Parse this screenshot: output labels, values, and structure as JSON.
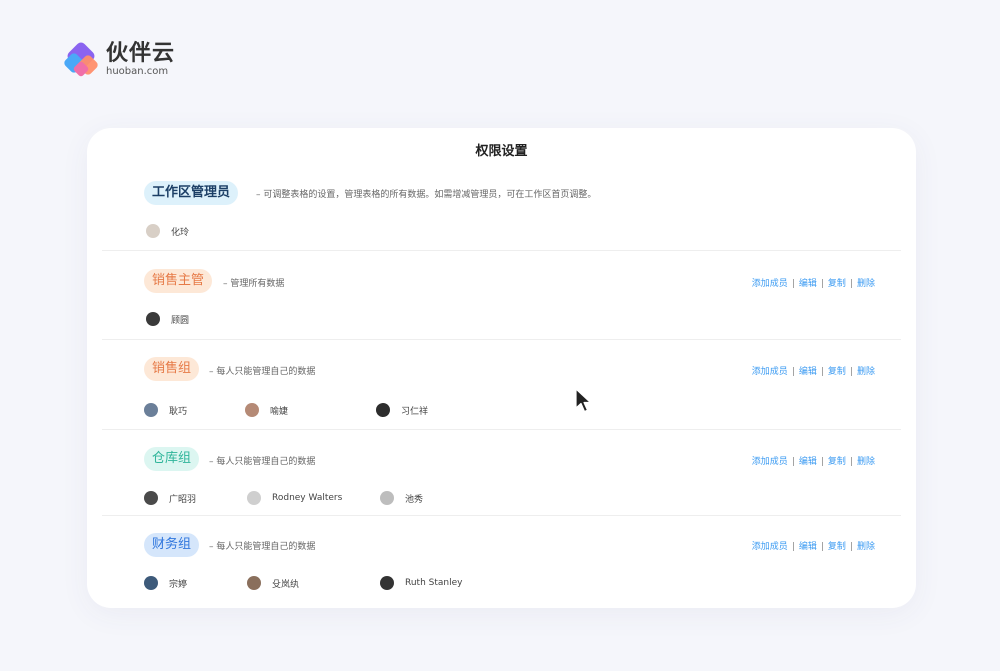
{
  "brand": {
    "name": "伙伴云",
    "domain": "huoban.com"
  },
  "panel": {
    "title": "权限设置"
  },
  "actions": {
    "add": "添加成员",
    "edit": "编辑",
    "copy": "复制",
    "delete": "删除",
    "separator": "|"
  },
  "groups": [
    {
      "name": "工作区管理员",
      "description": "– 可调整表格的设置，管理表格的所有数据。如需增减管理员，可在工作区首页调整。",
      "color": "#1c3f66",
      "members": [
        {
          "name": "化玲",
          "avatar_color": "#d8cfc6"
        }
      ]
    },
    {
      "name": "销售主管",
      "description": "– 管理所有数据",
      "color": "#e67a47",
      "members": [
        {
          "name": "顾圆",
          "avatar_color": "#3a3a3a"
        }
      ]
    },
    {
      "name": "销售组",
      "description": "– 每人只能管理自己的数据",
      "color": "#e67a47",
      "members": [
        {
          "name": "耿巧",
          "avatar_color": "#6b7f99"
        },
        {
          "name": "喻婕",
          "avatar_color": "#b58a76"
        },
        {
          "name": "习仁祥",
          "avatar_color": "#2d2d2d"
        }
      ]
    },
    {
      "name": "仓库组",
      "description": "– 每人只能管理自己的数据",
      "color": "#2fb59a",
      "members": [
        {
          "name": "广昭羽",
          "avatar_color": "#4a4a4a"
        },
        {
          "name": "Rodney Walters",
          "avatar_color": "#cfcfcf"
        },
        {
          "name": "池秀",
          "avatar_color": "#bdbdbd"
        }
      ]
    },
    {
      "name": "财务组",
      "description": "– 每人只能管理自己的数据",
      "color": "#2f76dd",
      "members": [
        {
          "name": "宗婷",
          "avatar_color": "#3d5a7a"
        },
        {
          "name": "殳岚纨",
          "avatar_color": "#8a6f5c"
        },
        {
          "name": "Ruth Stanley",
          "avatar_color": "#333333"
        }
      ]
    }
  ]
}
